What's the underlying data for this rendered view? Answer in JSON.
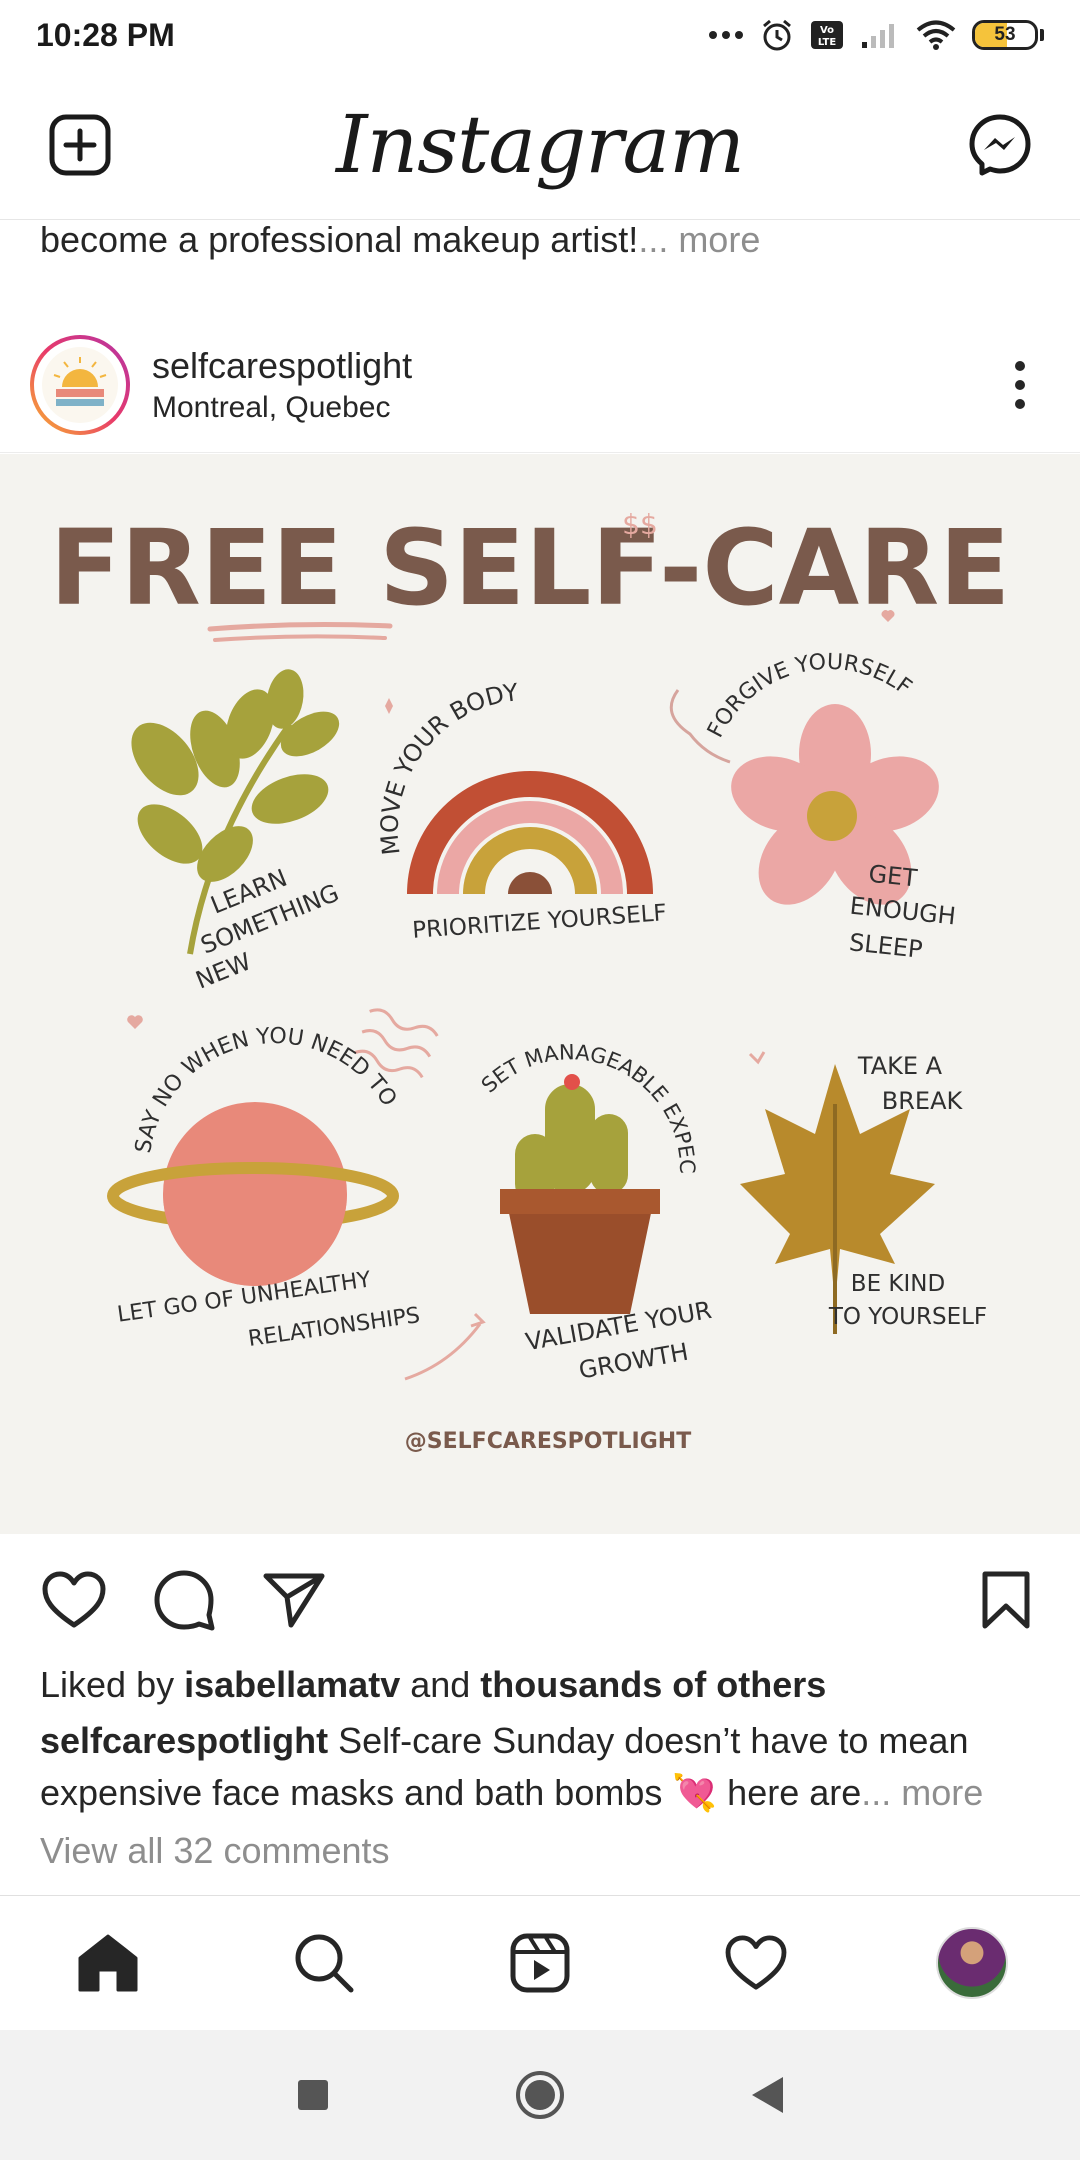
{
  "status": {
    "time": "10:28 PM",
    "battery": "53",
    "battery_level": 0.53
  },
  "header": {
    "logo": "Instagram"
  },
  "previous_post": {
    "caption_text": "become a professional makeup artist!",
    "more": "... more"
  },
  "post": {
    "username": "selfcarespotlight",
    "location": "Montreal, Quebec",
    "image": {
      "title": "FREE SELF-CARE",
      "dollar_mark": "$$",
      "handle": "@SELFCARESPOTLIGHT",
      "items": {
        "learn": [
          "LEARN",
          "SOMETHING",
          "NEW"
        ],
        "move": "MOVE YOUR BODY",
        "prioritize": "PRIORITIZE YOURSELF",
        "forgive": "FORGIVE YOURSELF",
        "sleep": [
          "GET",
          "ENOUGH",
          "SLEEP"
        ],
        "say_no": "SAY NO WHEN YOU NEED TO",
        "let_go": [
          "LET GO OF UNHEALTHY",
          "RELATIONSHIPS"
        ],
        "expectations": "SET MANAGEABLE EXPECTATIONS",
        "validate": [
          "VALIDATE YOUR",
          "GROWTH"
        ],
        "break": [
          "TAKE A",
          "BREAK"
        ],
        "kind": [
          "BE KIND",
          "TO YOURSELF"
        ]
      }
    },
    "liked_by_prefix": "Liked by ",
    "liked_by_user": "isabellamatv",
    "liked_by_and": " and ",
    "liked_by_others": "thousands of others",
    "caption_user": "selfcarespotlight",
    "caption_text": " Self-care Sunday doesn’t have to mean expensive face masks and bath bombs 💘 here are",
    "caption_more": "... more",
    "view_comments": "View all 32 comments"
  },
  "colors": {
    "text": "#262626",
    "muted": "#8e8e8e",
    "brown": "#7a5a4c",
    "olive": "#a6a23c",
    "pink": "#eba7a5",
    "rust": "#b55932",
    "mustard": "#c8a23a"
  }
}
